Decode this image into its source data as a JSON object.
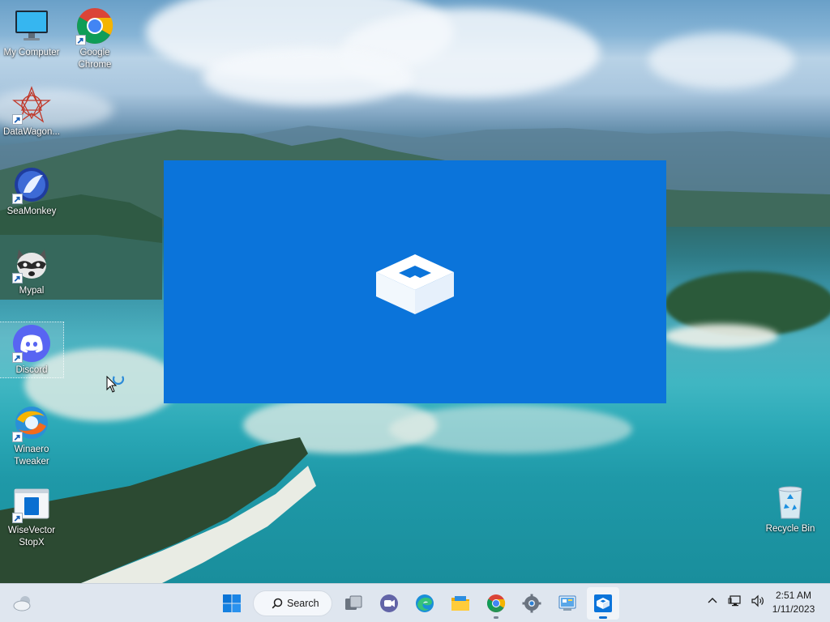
{
  "desktop": {
    "icons": [
      {
        "label": "My Computer",
        "icon": "monitor-icon",
        "shortcut": false
      },
      {
        "label": "Google Chrome",
        "icon": "chrome-icon",
        "shortcut": true
      },
      {
        "label": "DataWagon...",
        "icon": "datawagon-icon",
        "shortcut": true
      },
      {
        "label": "SeaMonkey",
        "icon": "seamonkey-icon",
        "shortcut": true
      },
      {
        "label": "Mypal",
        "icon": "raccoon-icon",
        "shortcut": true
      },
      {
        "label": "Discord",
        "icon": "discord-icon",
        "shortcut": true,
        "selected": true
      },
      {
        "label": "Winaero Tweaker",
        "icon": "winaero-icon",
        "shortcut": true
      },
      {
        "label": "WiseVector StopX",
        "icon": "wisevector-icon",
        "shortcut": true
      },
      {
        "label": "Recycle Bin",
        "icon": "recycle-bin-icon",
        "shortcut": false
      }
    ]
  },
  "splash": {
    "app": "Windows Sandbox",
    "background_color": "#0b74da",
    "icon": "sandbox-box-icon"
  },
  "taskbar": {
    "search_label": "Search",
    "apps": [
      {
        "name": "Start",
        "icon": "windows-start-icon"
      },
      {
        "name": "Task View",
        "icon": "task-view-icon"
      },
      {
        "name": "Chat",
        "icon": "teams-chat-icon"
      },
      {
        "name": "Microsoft Edge",
        "icon": "edge-icon"
      },
      {
        "name": "File Explorer",
        "icon": "file-explorer-icon"
      },
      {
        "name": "Google Chrome",
        "icon": "chrome-icon",
        "running": true
      },
      {
        "name": "Settings",
        "icon": "settings-gear-icon"
      },
      {
        "name": "Control Panel",
        "icon": "control-panel-icon"
      },
      {
        "name": "Windows Sandbox",
        "icon": "sandbox-icon",
        "active": true
      }
    ],
    "tray": [
      "chevron-up-icon",
      "network-icon",
      "volume-icon"
    ],
    "clock": {
      "time": "2:51 AM",
      "date": "1/11/2023"
    },
    "weather_icon": "weather-cloud-icon"
  }
}
